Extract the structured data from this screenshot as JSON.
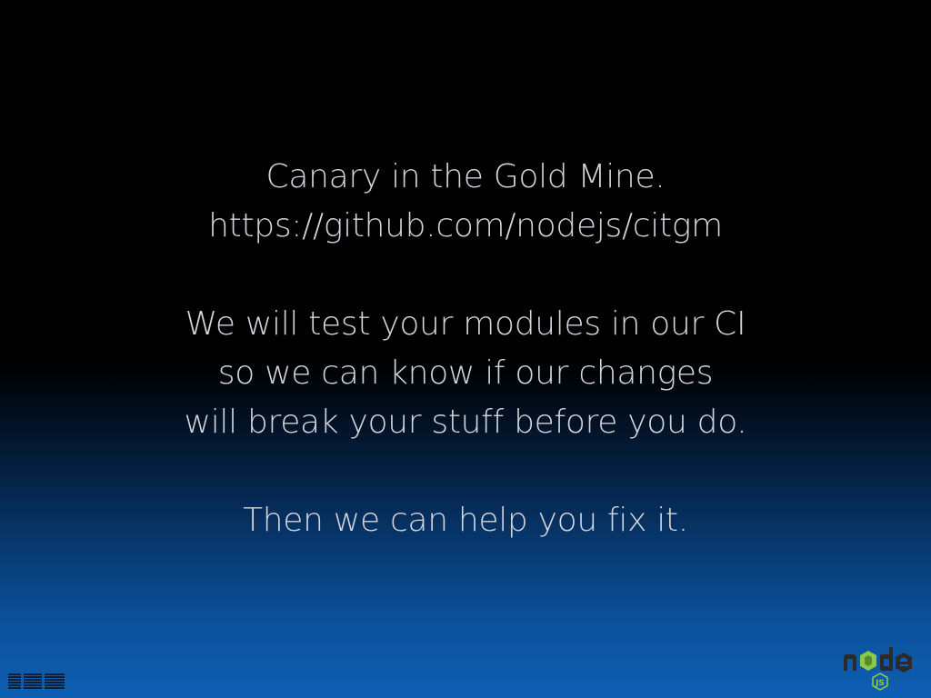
{
  "slide": {
    "lines": [
      "Canary in the Gold Mine.",
      "https://github.com/nodejs/citgm",
      "We will test your modules in our CI",
      "so we can know if our changes",
      "will break your stuff before you do.",
      "Then we can help you fix it."
    ]
  },
  "logos": {
    "left": "ibm-logo",
    "right": "nodejs-logo"
  },
  "colors": {
    "text": "#d2d6dc",
    "background_top": "#000000",
    "background_bottom": "#0e5fb3",
    "node_green": "#8cc84b",
    "node_dark": "#333333"
  }
}
